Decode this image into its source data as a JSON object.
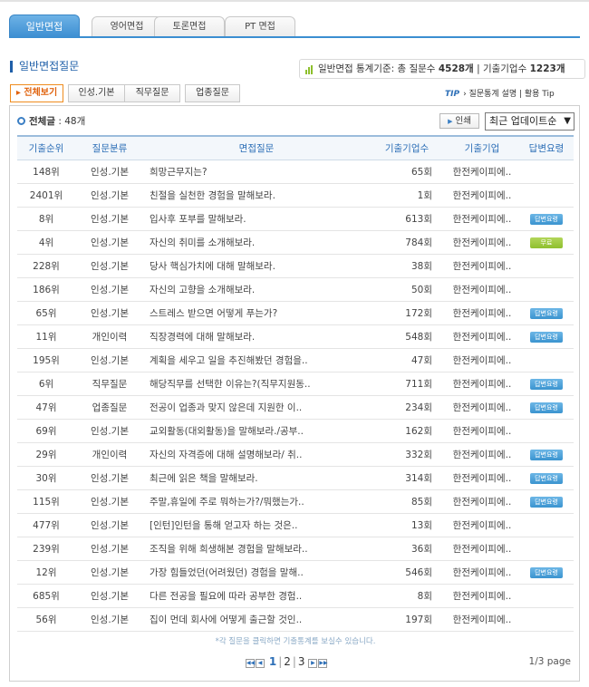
{
  "main_tabs": [
    "일반면접",
    "영어면접",
    "토론면접",
    "PT 면접"
  ],
  "section_title": "일반면접질문",
  "stats": {
    "prefix": "일반면접 통계기준: 총 질문수",
    "question_count": "4528개",
    "separator": "| 기출기업수",
    "company_count": "1223개"
  },
  "sub_tabs": [
    "전체보기",
    "인성.기본",
    "직무질문",
    "업종질문"
  ],
  "tip": {
    "label": "TIP",
    "text": "› 질문통계 설명 | 활용 Tip"
  },
  "total": {
    "label": "전체글",
    "count": ": 48개"
  },
  "print_label": "인쇄",
  "sort": {
    "selected": "최근 업데이트순"
  },
  "columns": [
    "기출순위",
    "질문분류",
    "면접질문",
    "기출기업수",
    "기출기업",
    "답변요령"
  ],
  "rows": [
    {
      "rank": "148위",
      "category": "인성.기본",
      "question": "희망근무지는?",
      "count": "65회",
      "company": "한전케이피에..",
      "tip": ""
    },
    {
      "rank": "2401위",
      "category": "인성.기본",
      "question": "친절을 실천한 경험을 말해보라.",
      "count": "1회",
      "company": "한전케이피에..",
      "tip": ""
    },
    {
      "rank": "8위",
      "category": "인성.기본",
      "question": "입사후 포부를 말해보라.",
      "count": "613회",
      "company": "한전케이피에..",
      "tip": "답변요령"
    },
    {
      "rank": "4위",
      "category": "인성.기본",
      "question": "자신의 취미를 소개해보라.",
      "count": "784회",
      "company": "한전케이피에..",
      "tip": "무료"
    },
    {
      "rank": "228위",
      "category": "인성.기본",
      "question": "당사 핵심가치에 대해 말해보라.",
      "count": "38회",
      "company": "한전케이피에..",
      "tip": ""
    },
    {
      "rank": "186위",
      "category": "인성.기본",
      "question": "자신의 고향을 소개해보라.",
      "count": "50회",
      "company": "한전케이피에..",
      "tip": ""
    },
    {
      "rank": "65위",
      "category": "인성.기본",
      "question": "스트레스 받으면 어떻게 푸는가?",
      "count": "172회",
      "company": "한전케이피에..",
      "tip": "답변요령"
    },
    {
      "rank": "11위",
      "category": "개인이력",
      "question": "직장경력에 대해 말해보라.",
      "count": "548회",
      "company": "한전케이피에..",
      "tip": "답변요령"
    },
    {
      "rank": "195위",
      "category": "인성.기본",
      "question": "계획을 세우고 일을 추진해봤던 경험을..",
      "count": "47회",
      "company": "한전케이피에..",
      "tip": ""
    },
    {
      "rank": "6위",
      "category": "직무질문",
      "question": "해당직무를 선택한 이유는?(직무지원동..",
      "count": "711회",
      "company": "한전케이피에..",
      "tip": "답변요령"
    },
    {
      "rank": "47위",
      "category": "업종질문",
      "question": "전공이 업종과 맞지 않은데 지원한 이..",
      "count": "234회",
      "company": "한전케이피에..",
      "tip": "답변요령"
    },
    {
      "rank": "69위",
      "category": "인성.기본",
      "question": "교외활동(대외활동)을 말해보라./공부..",
      "count": "162회",
      "company": "한전케이피에..",
      "tip": ""
    },
    {
      "rank": "29위",
      "category": "개인이력",
      "question": "자신의 자격증에 대해 설명해보라/ 취..",
      "count": "332회",
      "company": "한전케이피에..",
      "tip": "답변요령"
    },
    {
      "rank": "30위",
      "category": "인성.기본",
      "question": "최근에 읽은 책을 말해보라.",
      "count": "314회",
      "company": "한전케이피에..",
      "tip": "답변요령"
    },
    {
      "rank": "115위",
      "category": "인성.기본",
      "question": "주말,휴일에 주로 뭐하는가?/뭐했는가..",
      "count": "85회",
      "company": "한전케이피에..",
      "tip": "답변요령"
    },
    {
      "rank": "477위",
      "category": "인성.기본",
      "question": "[인턴]인턴을 통해 얻고자 하는 것은..",
      "count": "13회",
      "company": "한전케이피에..",
      "tip": ""
    },
    {
      "rank": "239위",
      "category": "인성.기본",
      "question": "조직을 위해 희생해본 경험을 말해보라..",
      "count": "36회",
      "company": "한전케이피에..",
      "tip": ""
    },
    {
      "rank": "12위",
      "category": "인성.기본",
      "question": "가장 힘들었던(어려웠던) 경험을 말해..",
      "count": "546회",
      "company": "한전케이피에..",
      "tip": "답변요령"
    },
    {
      "rank": "685위",
      "category": "인성.기본",
      "question": "다른 전공을 필요에 따라 공부한 경험..",
      "count": "8회",
      "company": "한전케이피에..",
      "tip": ""
    },
    {
      "rank": "56위",
      "category": "인성.기본",
      "question": "집이 먼데 회사에 어떻게 출근할 것인..",
      "count": "197회",
      "company": "한전케이피에..",
      "tip": ""
    }
  ],
  "note": "*각 질문을 클릭하면 기출통계를 보실수 있습니다.",
  "pagination": {
    "pages": [
      "1",
      "2",
      "3"
    ],
    "current": "1",
    "info": "1/3 page"
  },
  "colors": {
    "accent": "#3b8ed1",
    "title": "#1f5fa8",
    "active_subtab": "#e0620d",
    "badge_blue": "#3b94cf",
    "badge_green": "#8fbf2e"
  }
}
